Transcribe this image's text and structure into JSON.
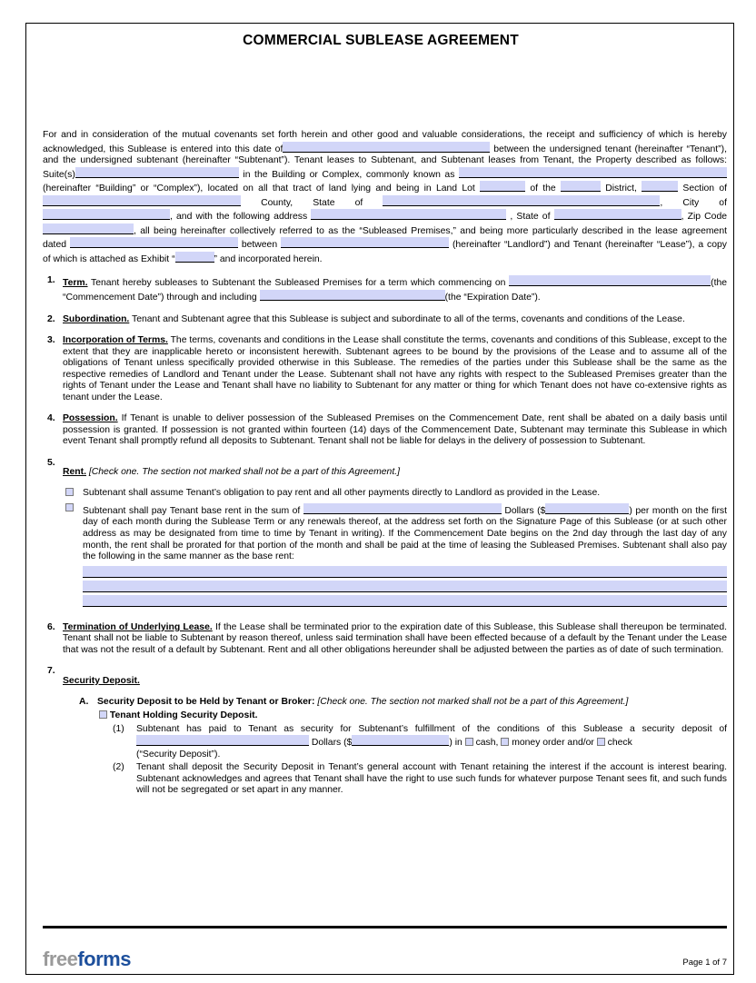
{
  "document": {
    "title": "COMMERCIAL SUBLEASE AGREEMENT",
    "page_label": "Page 1 of 7",
    "blank_fill_color": "#d2d6f8",
    "logo": {
      "part1": "free",
      "part2": "forms",
      "part1_color": "#9a9a9a",
      "part2_color": "#1d4f9c"
    }
  },
  "preamble": {
    "t1": "For and in consideration of the mutual covenants set forth herein and other good and valuable considerations, the receipt and sufficiency of which is hereby acknowledged, this Sublease is entered into this date of",
    "t2": "between the undersigned tenant (hereinafter “Tenant”), and the undersigned subtenant (hereinafter “Subtenant”). Tenant leases to Subtenant, and Subtenant leases from Tenant, the Property described as follows: Suite(s)",
    "t3": "in the Building or Complex, commonly known as",
    "t4": "(hereinafter “Building” or “Complex”), located on all that tract of land lying and being in Land Lot",
    "t5": "of the",
    "t6": "District,",
    "t7": "Section of",
    "t8": "County, State of",
    "t9": ", City of",
    "t10": ", State of",
    "t11": ", Zip Code",
    "t12": ", all being hereinafter collectively referred to as the “Subleased Premises,” and being more particularly described in the lease agreement dated",
    "t13": "between",
    "t14": "(hereinafter “Landlord”) and Tenant (hereinafter “Lease”), a copy of which is attached as Exhibit “",
    "t15": "” and incorporated herein.",
    "address_label": ", and with the following address"
  },
  "sections": [
    {
      "number": "1.",
      "heading": "Term.",
      "t1": "Tenant hereby subleases to Subtenant the Subleased Premises for a term which commencing on",
      "t2": "(the “Commencement Date”) through and including",
      "t3": "(the “Expiration Date”)."
    },
    {
      "number": "2.",
      "heading": "Subordination.",
      "body": "Tenant and Subtenant agree that this Sublease is subject and subordinate to all of the terms, covenants and conditions of the Lease."
    },
    {
      "number": "3.",
      "heading": "Incorporation of Terms.",
      "body": "The terms, covenants and conditions in the Lease shall constitute the terms, covenants and conditions of this Sublease, except to the extent that they are inapplicable hereto or inconsistent herewith. Subtenant agrees to be bound by the provisions of the Lease and to assume all of the obligations of Tenant unless specifically provided otherwise in this Sublease. The remedies of the parties under this Sublease shall be the same as the respective remedies of Landlord and Tenant under the Lease. Subtenant shall not have any rights with respect to the Subleased Premises greater than the rights of Tenant under the Lease and Tenant shall have no liability to Subtenant for any matter or thing for which Tenant does not have co-extensive rights as tenant under the Lease."
    },
    {
      "number": "4.",
      "heading": "Possession.",
      "body": "If Tenant is unable to deliver possession of the Subleased Premises on the Commencement Date, rent shall be abated on a daily basis until possession is granted. If possession is not granted within fourteen (14) days of the Commencement Date, Subtenant may terminate this Sublease in which event Tenant shall promptly refund all deposits to Subtenant. Tenant shall not be liable for delays in the delivery of possession to Subtenant."
    },
    {
      "number": "5.",
      "heading": "Rent.",
      "instruction": "[Check one. The section not marked shall not be a part of this Agreement.]",
      "option1": "Subtenant shall assume Tenant’s obligation to pay rent and all other payments directly to Landlord as provided in the Lease.",
      "option2_a": "Subtenant shall pay Tenant base rent in the sum of",
      "option2_b": "Dollars ($",
      "option2_c": ") per month on the first day of each month during the Sublease Term or any renewals thereof, at the address set forth on the Signature Page of this Sublease (or at such other address as may be designated from time to time by Tenant in writing). If the Commencement Date begins on the 2nd day through the last day of any month, the rent shall be prorated for that portion of the month and shall be paid at the time of leasing the Subleased Premises. Subtenant shall also pay the following in the same manner as the base rent:",
      "blank_lines": 3
    },
    {
      "number": "6.",
      "heading": "Termination of Underlying Lease.",
      "body": "If the Lease shall be terminated prior to the expiration date of this Sublease, this Sublease shall thereupon be terminated. Tenant shall not be liable to Subtenant by reason thereof, unless said termination shall have been effected because of a default by the Tenant under the Lease that was not the result of a default by Subtenant. Rent and all other obligations hereunder shall be adjusted between the parties as of date of such termination."
    },
    {
      "number": "7.",
      "heading": "Security Deposit.",
      "sub_a_label": "A.",
      "sub_a_title": "Security Deposit to be Held by Tenant or Broker:",
      "sub_a_instruction": "[Check one. The section not marked shall not be a part of this Agreement.]",
      "checkbox_label": "Tenant Holding Security Deposit.",
      "item1_label": "(1)",
      "item1_a": "Subtenant has paid to Tenant as security for Subtenant’s fulfillment of the conditions of this Sublease a security deposit of",
      "item1_b": "Dollars ($",
      "item1_c": ") in",
      "item1_cash": "cash,",
      "item1_money_order": "money order and/or",
      "item1_check": "check",
      "item1_d": "(“Security Deposit”).",
      "item2_label": "(2)",
      "item2_body": "Tenant shall deposit the Security Deposit in Tenant’s general account with Tenant retaining the interest if the account is interest bearing. Subtenant acknowledges and agrees that Tenant shall have the right to use such funds for whatever purpose Tenant sees fit, and such funds will not be segregated or set apart in any manner."
    }
  ]
}
